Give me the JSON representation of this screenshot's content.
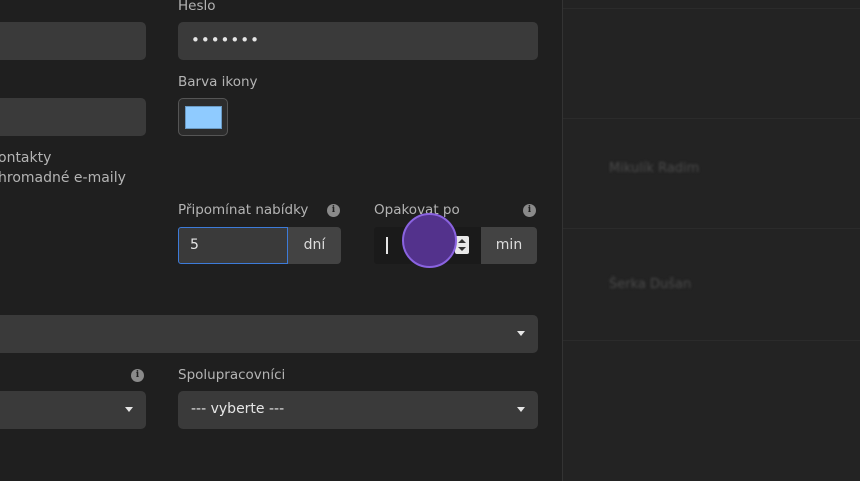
{
  "form": {
    "password": {
      "label": "Heslo",
      "value": "•••••••"
    },
    "icon_color": {
      "label": "Barva ikony",
      "color": "#8fcbff"
    },
    "checkbox_lines": [
      "ontakty",
      "hromadné e-maily"
    ],
    "remind_offers": {
      "label": "Připomínat nabídky",
      "value": "5",
      "unit": "dní"
    },
    "repeat_after": {
      "label": "Opakovat po",
      "value": "",
      "unit": "min"
    },
    "collaborators": {
      "label": "Spolupracovníci",
      "value": "--- vyberte ---"
    }
  },
  "right_pane": {
    "blurred_items": [
      "Mikulík Radim",
      "Šerka Dušan"
    ]
  }
}
